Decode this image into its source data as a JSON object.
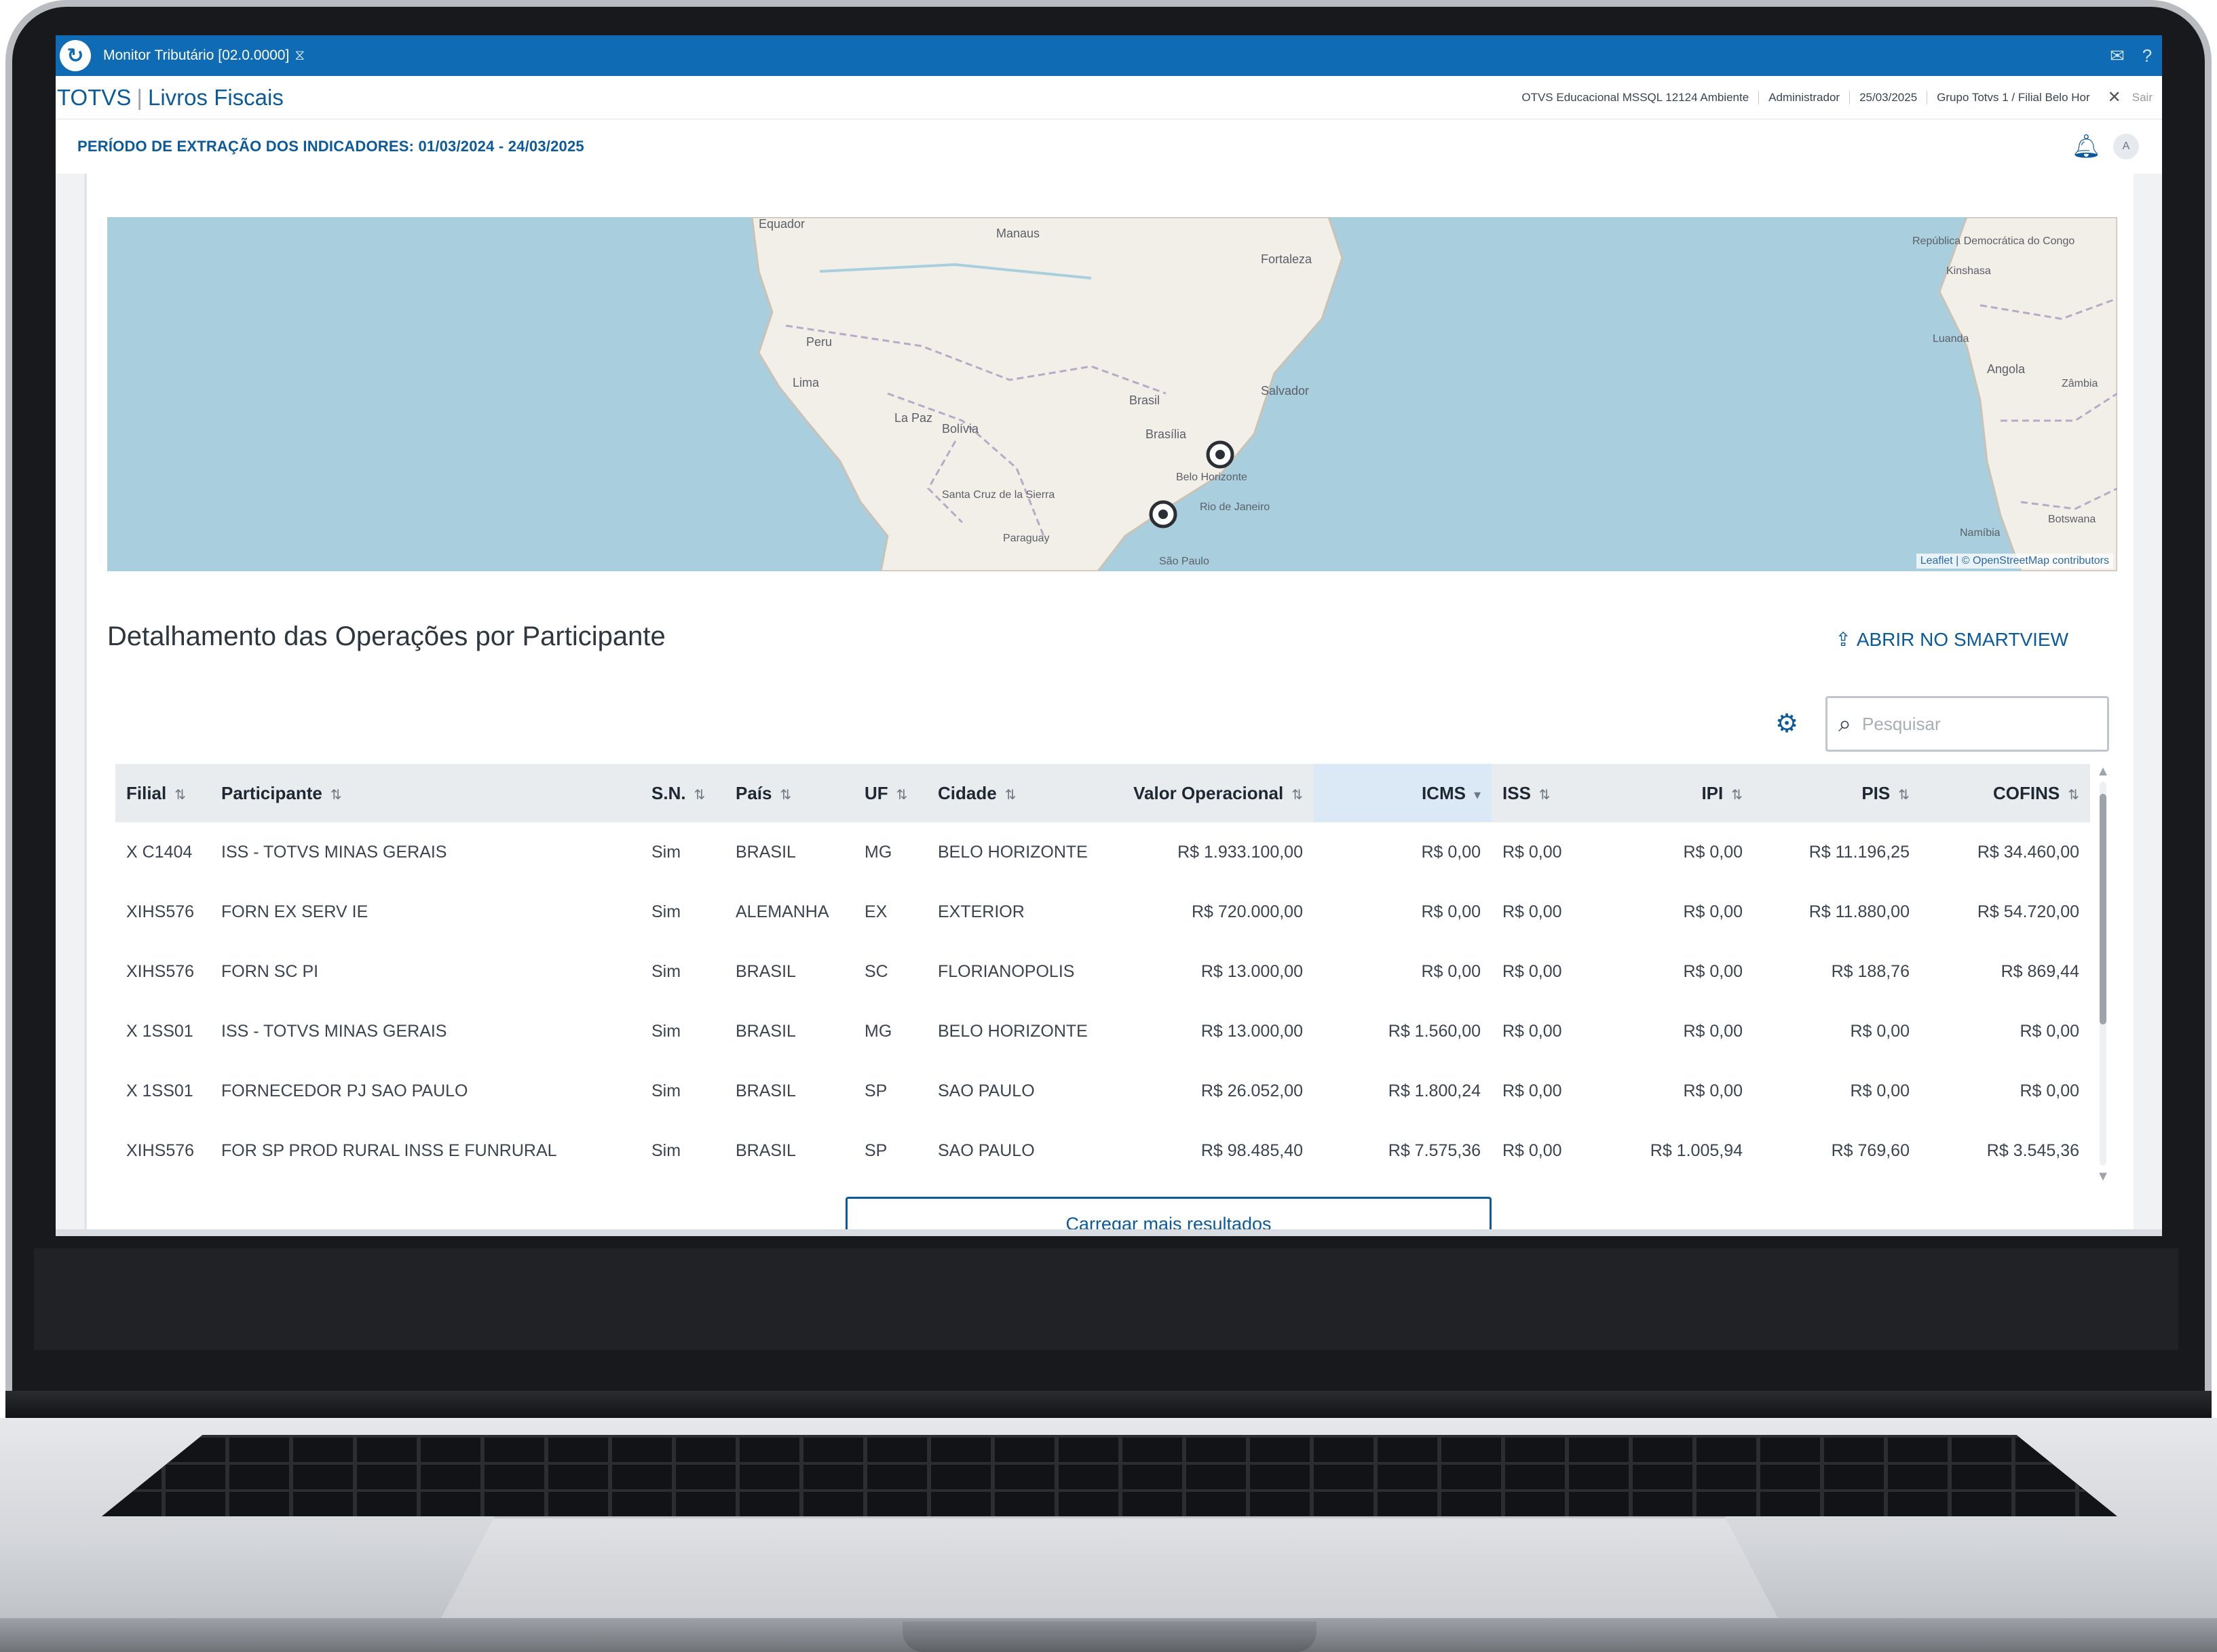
{
  "window": {
    "title": "Monitor Tributário [02.0.0000]",
    "logo": "totvs-logo-icon"
  },
  "appbar": {
    "brand_name": "TOTVS",
    "brand_module": "Livros Fiscais",
    "context": [
      "OTVS Educacional MSSQL 12124 Ambiente",
      "Administrador",
      "25/03/2025",
      "Grupo Totvs 1 / Filial Belo Hor"
    ],
    "exit": "Sair"
  },
  "period": {
    "label": "PERÍODO DE EXTRAÇÃO DOS INDICADORES: 01/03/2024 - 24/03/2025"
  },
  "map": {
    "labels": [
      "Equador",
      "Manaus",
      "Fortaleza",
      "Peru",
      "Lima",
      "Brasil",
      "Brasília",
      "Salvador",
      "La Paz",
      "Bolívia",
      "Santa Cruz de la Sierra",
      "Belo Horizonte",
      "Rio de Janeiro",
      "São Paulo",
      "Paraguay",
      "República Democrática do Congo",
      "Kinshasa",
      "Luanda",
      "Angola",
      "Zâmbia",
      "Namíbia",
      "Botswana"
    ],
    "attribution": "Leaflet | © OpenStreetMap contributors"
  },
  "section": {
    "title": "Detalhamento das Operações por Participante",
    "smartview_label": "ABRIR NO SMARTVIEW"
  },
  "search": {
    "placeholder": "Pesquisar"
  },
  "table": {
    "headers": {
      "filial": "Filial",
      "participante": "Participante",
      "sn": "S.N.",
      "pais": "País",
      "uf": "UF",
      "cidade": "Cidade",
      "valor": "Valor Operacional",
      "icms": "ICMS",
      "iss": "ISS",
      "ipi": "IPI",
      "pis": "PIS",
      "cofins": "COFINS"
    },
    "rows": [
      {
        "filial": "X C1404",
        "participante": "ISS - TOTVS MINAS GERAIS",
        "sn": "Sim",
        "pais": "BRASIL",
        "uf": "MG",
        "cidade": "BELO HORIZONTE",
        "valor": "R$ 1.933.100,00",
        "icms": "R$ 0,00",
        "iss": "R$ 0,00",
        "ipi": "R$ 0,00",
        "pis": "R$ 11.196,25",
        "cofins": "R$ 34.460,00"
      },
      {
        "filial": "XIHS576",
        "participante": "FORN EX SERV IE",
        "sn": "Sim",
        "pais": "ALEMANHA",
        "uf": "EX",
        "cidade": "EXTERIOR",
        "valor": "R$ 720.000,00",
        "icms": "R$ 0,00",
        "iss": "R$ 0,00",
        "ipi": "R$ 0,00",
        "pis": "R$ 11.880,00",
        "cofins": "R$ 54.720,00"
      },
      {
        "filial": "XIHS576",
        "participante": "FORN SC PI",
        "sn": "Sim",
        "pais": "BRASIL",
        "uf": "SC",
        "cidade": "FLORIANOPOLIS",
        "valor": "R$ 13.000,00",
        "icms": "R$ 0,00",
        "iss": "R$ 0,00",
        "ipi": "R$ 0,00",
        "pis": "R$ 188,76",
        "cofins": "R$ 869,44"
      },
      {
        "filial": "X 1SS01",
        "participante": "ISS - TOTVS MINAS GERAIS",
        "sn": "Sim",
        "pais": "BRASIL",
        "uf": "MG",
        "cidade": "BELO HORIZONTE",
        "valor": "R$ 13.000,00",
        "icms": "R$ 1.560,00",
        "iss": "R$ 0,00",
        "ipi": "R$ 0,00",
        "pis": "R$ 0,00",
        "cofins": "R$ 0,00"
      },
      {
        "filial": "X 1SS01",
        "participante": "FORNECEDOR PJ SAO PAULO",
        "sn": "Sim",
        "pais": "BRASIL",
        "uf": "SP",
        "cidade": "SAO PAULO",
        "valor": "R$ 26.052,00",
        "icms": "R$ 1.800,24",
        "iss": "R$ 0,00",
        "ipi": "R$ 0,00",
        "pis": "R$ 0,00",
        "cofins": "R$ 0,00"
      },
      {
        "filial": "XIHS576",
        "participante": "FOR SP PROD RURAL INSS E FUNRURAL",
        "sn": "Sim",
        "pais": "BRASIL",
        "uf": "SP",
        "cidade": "SAO PAULO",
        "valor": "R$ 98.485,40",
        "icms": "R$ 7.575,36",
        "iss": "R$ 0,00",
        "ipi": "R$ 1.005,94",
        "pis": "R$ 769,60",
        "cofins": "R$ 3.545,36"
      }
    ]
  },
  "load_more_label": "Carregar mais resultados",
  "colors": {
    "primary": "#0f6bb3",
    "ocean": "#a9cfdf",
    "land": "#f2efe9"
  }
}
